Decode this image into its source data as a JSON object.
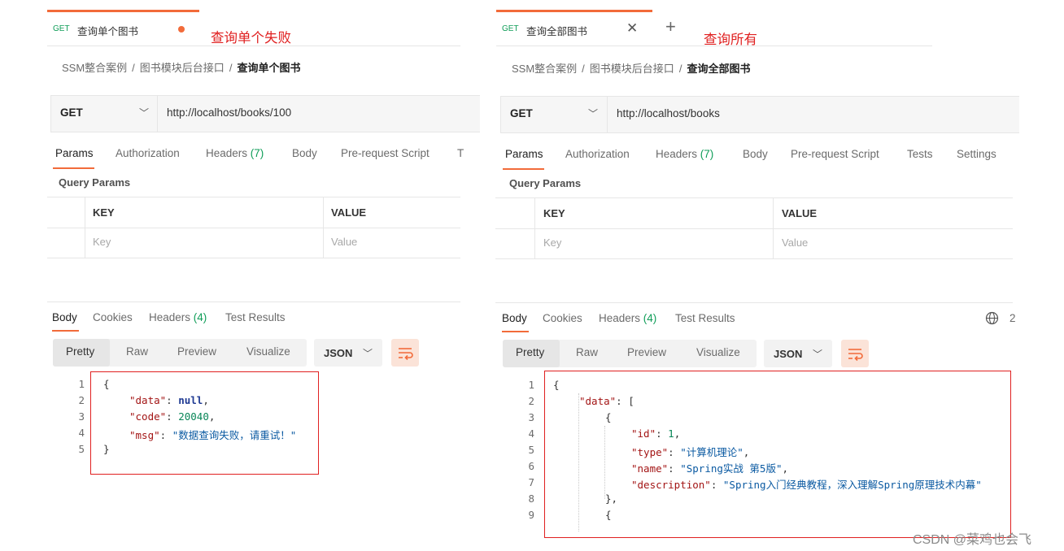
{
  "left": {
    "tab": {
      "method": "GET",
      "title": "查询单个图书"
    },
    "annotation": "查询单个失败",
    "breadcrumb": {
      "root": "SSM整合案例",
      "folder": "图书模块后台接口",
      "current": "查询单个图书",
      "sep": "/"
    },
    "request": {
      "method": "GET",
      "url": "http://localhost/books/100"
    },
    "req_tabs": [
      "Params",
      "Authorization",
      "Headers",
      "Body",
      "Pre-request Script",
      "T"
    ],
    "headers_count": "(7)",
    "query_params_label": "Query Params",
    "table": {
      "key_header": "KEY",
      "value_header": "VALUE",
      "key_placeholder": "Key",
      "value_placeholder": "Value"
    },
    "resp_tabs": [
      "Body",
      "Cookies",
      "Headers",
      "Test Results"
    ],
    "resp_headers_count": "(4)",
    "view_modes": [
      "Pretty",
      "Raw",
      "Preview",
      "Visualize"
    ],
    "format": "JSON",
    "code_lines": [
      "1",
      "2",
      "3",
      "4",
      "5"
    ],
    "code": {
      "l1": "{",
      "l2_key": "\"data\"",
      "l2_val": "null",
      "l3_key": "\"code\"",
      "l3_val": "20040",
      "l4_key": "\"msg\"",
      "l4_val": "\"数据查询失败，请重试！\"",
      "l5": "}"
    }
  },
  "right": {
    "tab": {
      "method": "GET",
      "title": "查询全部图书"
    },
    "annotation": "查询所有",
    "breadcrumb": {
      "root": "SSM整合案例",
      "folder": "图书模块后台接口",
      "current": "查询全部图书",
      "sep": "/"
    },
    "request": {
      "method": "GET",
      "url": "http://localhost/books"
    },
    "req_tabs": [
      "Params",
      "Authorization",
      "Headers",
      "Body",
      "Pre-request Script",
      "Tests",
      "Settings"
    ],
    "headers_count": "(7)",
    "query_params_label": "Query Params",
    "table": {
      "key_header": "KEY",
      "value_header": "VALUE",
      "key_placeholder": "Key",
      "value_placeholder": "Value"
    },
    "resp_tabs": [
      "Body",
      "Cookies",
      "Headers",
      "Test Results"
    ],
    "resp_headers_count": "(4)",
    "resp_extra": "2",
    "view_modes": [
      "Pretty",
      "Raw",
      "Preview",
      "Visualize"
    ],
    "format": "JSON",
    "code_lines": [
      "1",
      "2",
      "3",
      "4",
      "5",
      "6",
      "7",
      "8",
      "9"
    ],
    "code": {
      "l1": "{",
      "l2_key": "\"data\"",
      "l2_val": "[",
      "l3": "{",
      "l4_key": "\"id\"",
      "l4_val": "1",
      "l5_key": "\"type\"",
      "l5_val": "\"计算机理论\"",
      "l6_key": "\"name\"",
      "l6_val": "\"Spring实战 第5版\"",
      "l7_key": "\"description\"",
      "l7_val": "\"Spring入门经典教程，深入理解Spring原理技术内幕\"",
      "l8": "},",
      "l9": "{"
    }
  },
  "watermark": "CSDN @菜鸡也会飞",
  "colors": {
    "accent": "#f26b3a",
    "annotation_red": "#e02020",
    "get_green": "#0f9d58"
  },
  "icons": {
    "close": "close-icon",
    "plus": "plus-icon",
    "globe": "globe-icon",
    "wrap": "wrap-lines-icon",
    "chevron": "chevron-down-icon"
  }
}
